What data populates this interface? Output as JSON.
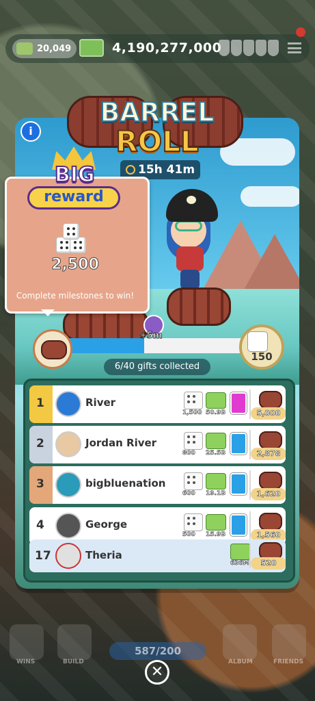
{
  "status_bar": {
    "net_worth": "20,049",
    "cash": "4,190,277,000"
  },
  "event": {
    "title_line1": "BARREL",
    "title_line2": "ROLL",
    "timer": "15h 41m",
    "info_label": "i"
  },
  "big_reward": {
    "badge_top": "BIG",
    "badge_bottom": "reward",
    "amount": "2,500",
    "description": "Complete milestones to win!"
  },
  "progress": {
    "milestone_bonus": "+5m",
    "goal_reward": "150",
    "gifts_text": "6/40 gifts collected",
    "fill_fraction": 0.45
  },
  "leaderboard": [
    {
      "rank": "1",
      "name": "River",
      "dice": "1,500",
      "cash": "50.9B",
      "card_color": "#e03ad0",
      "barrels": "5,000",
      "tab_color": "#f3c843"
    },
    {
      "rank": "2",
      "name": "Jordan River",
      "dice": "800",
      "cash": "25.5B",
      "card_color": "#2aa0e6",
      "barrels": "2,878",
      "tab_color": "#c9d3e0"
    },
    {
      "rank": "3",
      "name": "bigbluenation",
      "dice": "600",
      "cash": "19.1B",
      "card_color": "#2aa0e6",
      "barrels": "1,620",
      "tab_color": "#e3a77a"
    },
    {
      "rank": "4",
      "name": "George",
      "dice": "500",
      "cash": "15.9B",
      "card_color": "#2aa0e6",
      "barrels": "1,560",
      "tab_color": "#ffffff"
    }
  ],
  "me": {
    "rank": "17",
    "name": "Theria",
    "cash": "636M",
    "barrels": "520"
  },
  "bottom_nav": {
    "wins": "WINS",
    "build": "BUILD",
    "score": "587/200",
    "album": "ALBUM",
    "friends": "FRIENDS",
    "close": "✕"
  }
}
